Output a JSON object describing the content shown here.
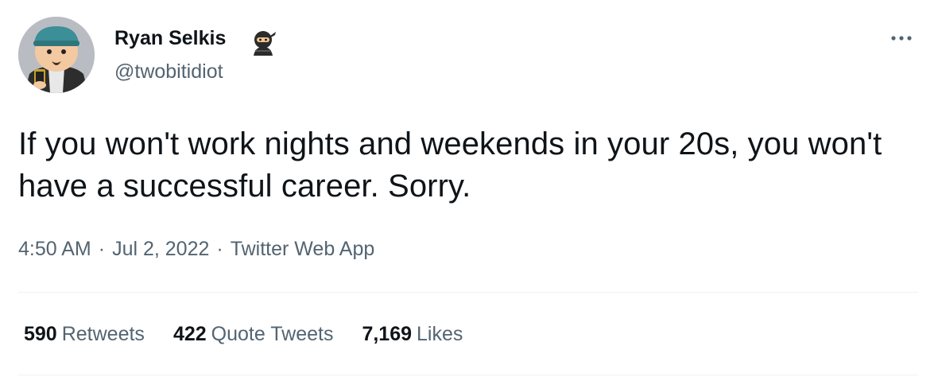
{
  "user": {
    "display_name": "Ryan Selkis",
    "handle": "@twobitidiot",
    "badge_icon": "ninja-emoji-icon",
    "avatar": "cartoon-avatar"
  },
  "tweet": {
    "text": "If you won't work nights and weekends in your 20s, you won't have a successful career. Sorry.",
    "time": "4:50 AM",
    "date": "Jul 2, 2022",
    "source": "Twitter Web App",
    "separator": "·"
  },
  "stats": [
    {
      "count": "590",
      "label": "Retweets"
    },
    {
      "count": "422",
      "label": "Quote Tweets"
    },
    {
      "count": "7,169",
      "label": "Likes"
    }
  ],
  "menu": {
    "icon": "more-horizontal-icon"
  },
  "colors": {
    "text_primary": "#0f1419",
    "text_secondary": "#536471",
    "divider": "#eff3f4"
  }
}
